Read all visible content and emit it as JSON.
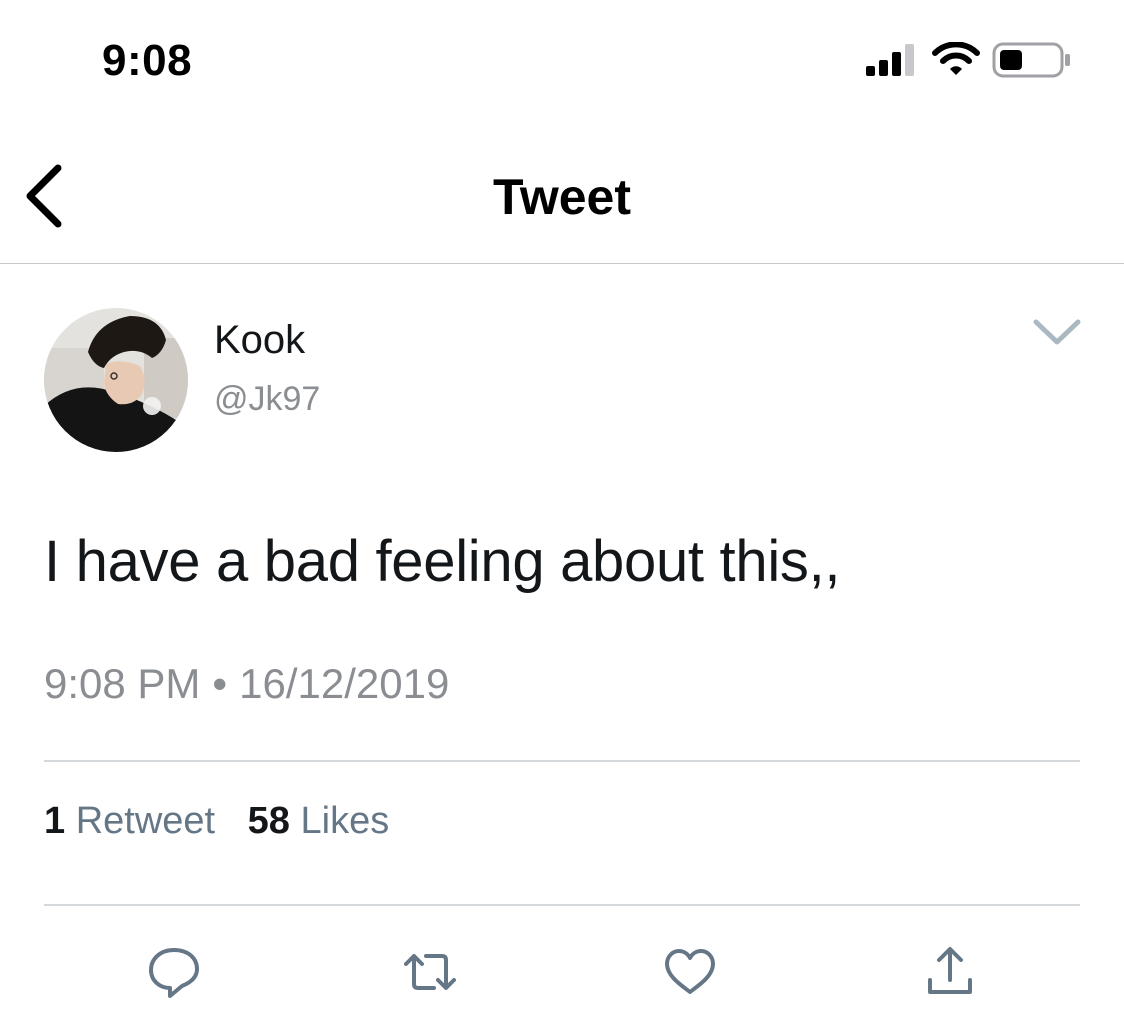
{
  "status_bar": {
    "time": "9:08",
    "icons": [
      "signal-icon",
      "wifi-icon",
      "battery-icon"
    ]
  },
  "nav": {
    "title": "Tweet",
    "back_icon": "chevron-left-icon"
  },
  "tweet": {
    "author": {
      "name": "Kook",
      "handle": "@Jk97"
    },
    "text": "I have a bad feeling about this,,",
    "time": "9:08 PM",
    "separator": "•",
    "date": "16/12/2019",
    "stats": {
      "retweet_count": "1",
      "retweet_label": "Retweet",
      "like_count": "58",
      "like_label": "Likes"
    },
    "actions": [
      "reply-icon",
      "retweet-icon",
      "like-icon",
      "share-icon"
    ]
  },
  "colors": {
    "text": "#14171a",
    "secondary": "#8a8d91",
    "stat_label": "#657786",
    "divider": "#d6d9dc",
    "action_icon": "#657786"
  }
}
